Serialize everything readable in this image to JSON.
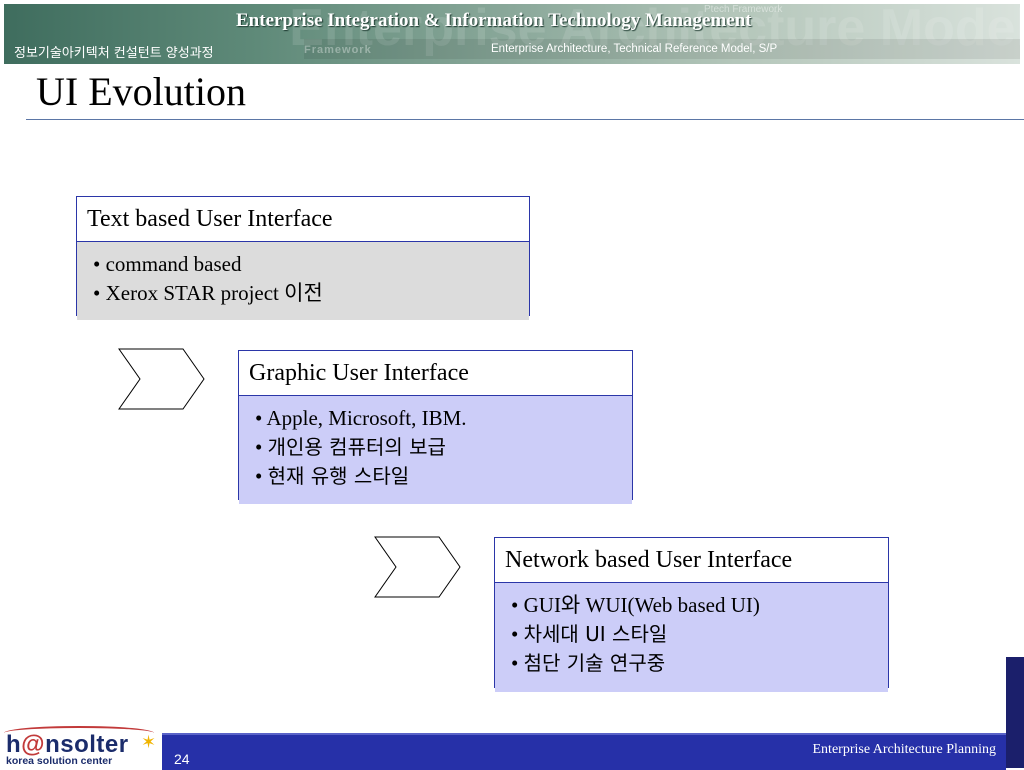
{
  "header": {
    "title": "Enterprise Integration & Information Technology Management",
    "course": "정보기술아키텍처 컨설턴트 양성과정",
    "subtitle": "Enterprise Architecture, Technical Reference Model, S/P",
    "watermark": "Enterprise Architecture Model",
    "watermark_small": "Framework",
    "watermark_top": "Ptech Framework"
  },
  "slide": {
    "title": "UI Evolution"
  },
  "stages": [
    {
      "heading": "Text based User Interface",
      "items": [
        "command based",
        "Xerox STAR project 이전"
      ]
    },
    {
      "heading": "Graphic User Interface",
      "items": [
        "Apple, Microsoft, IBM.",
        "개인용 컴퓨터의 보급",
        "현재 유행 스타일"
      ]
    },
    {
      "heading": "Network based User Interface",
      "items": [
        "GUI와 WUI(Web based UI)",
        "차세대 UI 스타일",
        "첨단 기술 연구중"
      ]
    }
  ],
  "footer": {
    "page_number": "24",
    "right_text": "Enterprise Architecture Planning"
  },
  "logo": {
    "name_part1": "h",
    "name_at": "@",
    "name_part2": "nsolter",
    "tagline": "korea solution center"
  },
  "colors": {
    "box_border": "#2b36a8",
    "box1_fill": "#dcdcdc",
    "box_fill": "#cccdf8",
    "footer_bar": "#2630a8",
    "banner": "#3f6d5e"
  },
  "icons": [
    "chevron-right-icon",
    "chevron-right-icon",
    "star-icon"
  ]
}
